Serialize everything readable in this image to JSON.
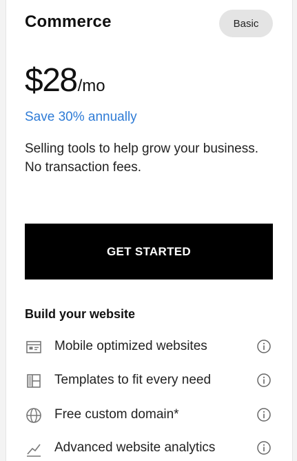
{
  "plan": {
    "name": "Commerce",
    "badge": "Basic",
    "price": "$28",
    "price_unit": "/mo",
    "save_text": "Save 30% annually",
    "description": [
      "Selling tools to help grow your business.",
      "No transaction fees."
    ],
    "cta_label": "GET STARTED"
  },
  "features_section": {
    "title": "Build your website",
    "items": [
      {
        "label": "Mobile optimized websites",
        "icon": "browser-window-icon"
      },
      {
        "label": "Templates to fit every need",
        "icon": "layout-template-icon"
      },
      {
        "label": "Free custom domain*",
        "icon": "globe-icon"
      },
      {
        "label": "Advanced website analytics",
        "icon": "analytics-chart-icon"
      }
    ],
    "info_icon": "info-icon"
  },
  "colors": {
    "accent_link": "#2e7bd6",
    "cta_background": "#000000",
    "badge_background": "#e4e4e4",
    "icon_gray": "#777777"
  }
}
